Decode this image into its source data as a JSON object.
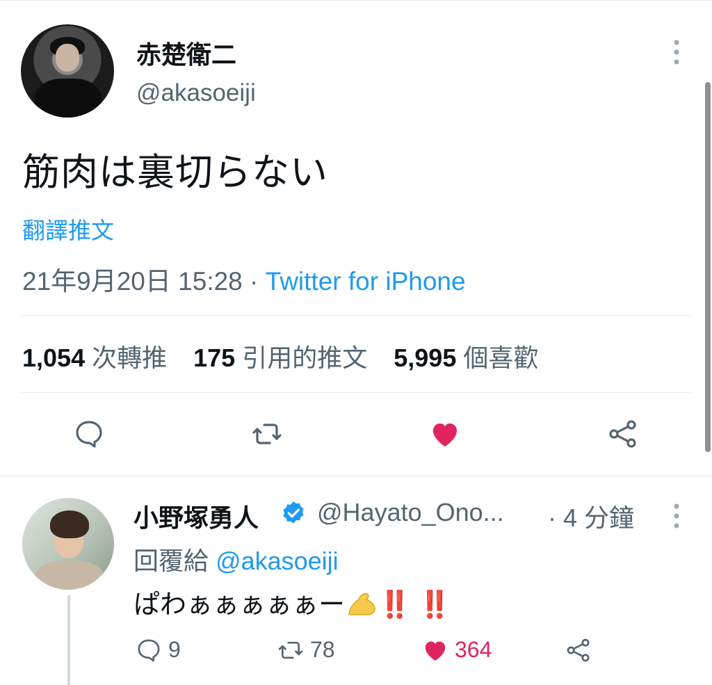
{
  "main_tweet": {
    "author_name": "赤楚衛二",
    "author_handle": "@akasoeiji",
    "text": "筋肉は裏切らない",
    "translate_label": "翻譯推文",
    "timestamp": "21年9月20日 15:28",
    "separator": " · ",
    "source": "Twitter for iPhone",
    "stats": {
      "retweets_count": "1,054",
      "retweets_label": "次轉推",
      "quotes_count": "175",
      "quotes_label": "引用的推文",
      "likes_count": "5,995",
      "likes_label": "個喜歡"
    },
    "actions": [
      "reply-icon",
      "retweet-icon",
      "like-icon-filled",
      "share-icon"
    ],
    "more_icon": "⋮"
  },
  "reply_tweet": {
    "author_name": "小野塚勇人",
    "author_handle": "@Hayato_Ono...",
    "time_ago": "· 4 分鐘",
    "reply_prefix": "回覆給",
    "reply_to": "@akasoeiji",
    "text": "ぱわぁぁぁぁぁー",
    "exclamations": "‼️ ‼️",
    "reply_count": "9",
    "retweet_count": "78",
    "like_count": "364",
    "more_icon": "⋮"
  },
  "colors": {
    "accent": "#1d9bf0",
    "like": "#e0245e",
    "secondary_text": "#536471"
  }
}
